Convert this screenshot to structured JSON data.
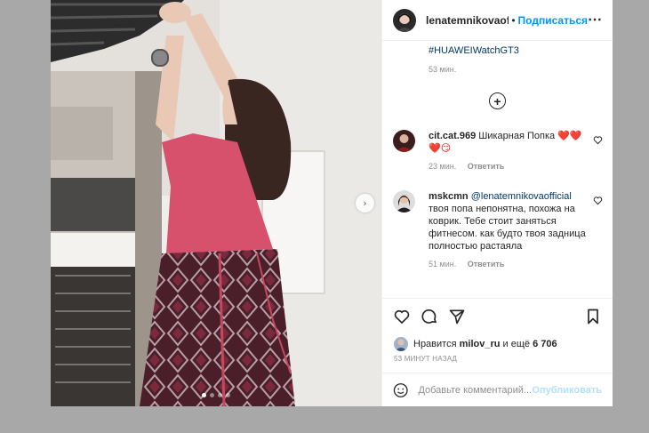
{
  "post": {
    "username": "lenatemnikovaofficial",
    "separator": "•",
    "follow_label": "Подписаться",
    "more_label": "•••",
    "carousel": {
      "current": 1,
      "total": 4
    }
  },
  "caption": {
    "hashtag": "#HUAWEIWatchGT3",
    "time": "53 мин."
  },
  "comments": [
    {
      "username": "cit.cat.969",
      "text": "Шикарная Попка",
      "emojis": "❤️❤️❤️😏",
      "time": "23 мин.",
      "reply_label": "Ответить"
    },
    {
      "username": "mskcmn",
      "mention": "@lenatemnikovaofficial",
      "text": "твоя попа непонятна, похожа на коврик. Тебе стоит заняться фитнесом. как будто твоя задница полностью растаяла",
      "time": "51 мин.",
      "reply_label": "Ответить"
    }
  ],
  "likes": {
    "prefix": "Нравится",
    "liker": "milov_ru",
    "and": "и ещё",
    "count": "6 706"
  },
  "date": "53 МИНУТ НАЗАД",
  "add_comment": {
    "placeholder": "Добавьте комментарий...",
    "publish_label": "Опубликовать"
  },
  "icons": {
    "heart": "heart-icon",
    "comment": "comment-icon",
    "share": "share-icon",
    "save": "bookmark-icon",
    "emoji": "smile-icon",
    "next": "chevron-right-icon",
    "load_more": "plus-circle-icon"
  },
  "colors": {
    "accent": "#0095f6",
    "link": "#00376b",
    "muted": "#8e8e8e"
  }
}
